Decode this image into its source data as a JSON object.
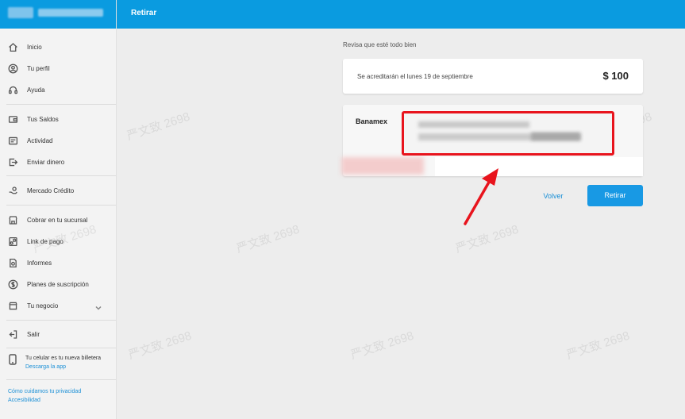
{
  "topbar": {
    "title": "Retirar"
  },
  "sidebar": {
    "items": [
      {
        "label": "Inicio",
        "icon": "home-icon"
      },
      {
        "label": "Tu perfil",
        "icon": "profile-icon"
      },
      {
        "label": "Ayuda",
        "icon": "headset-icon"
      },
      {
        "label": "Tus Saldos",
        "icon": "wallet-icon"
      },
      {
        "label": "Actividad",
        "icon": "activity-icon"
      },
      {
        "label": "Enviar dinero",
        "icon": "send-money-icon"
      },
      {
        "label": "Mercado Crédito",
        "icon": "credit-icon"
      },
      {
        "label": "Cobrar en tu sucursal",
        "icon": "store-icon"
      },
      {
        "label": "Link de pago",
        "icon": "link-icon"
      },
      {
        "label": "Informes",
        "icon": "report-icon"
      },
      {
        "label": "Planes de suscripción",
        "icon": "subscription-icon"
      },
      {
        "label": "Tu negocio",
        "icon": "business-icon"
      },
      {
        "label": "Salir",
        "icon": "logout-icon"
      }
    ],
    "app_promo": {
      "text": "Tu celular es tu nueva billetera",
      "link": "Descarga la app"
    },
    "footer": {
      "privacy": "Cómo cuidamos tu privacidad",
      "accessibility": "Accesibilidad"
    }
  },
  "main": {
    "review_label": "Revisa que esté todo bien",
    "credit_text": "Se acreditarán el lunes 19 de septiembre",
    "amount": "$ 100",
    "bank_name": "Banamex",
    "buttons": {
      "back": "Volver",
      "withdraw": "Retirar"
    }
  },
  "watermark": "严文致 2698",
  "colors": {
    "brand": "#0a9be0",
    "button": "#1899e4",
    "highlight": "#e8141d"
  }
}
